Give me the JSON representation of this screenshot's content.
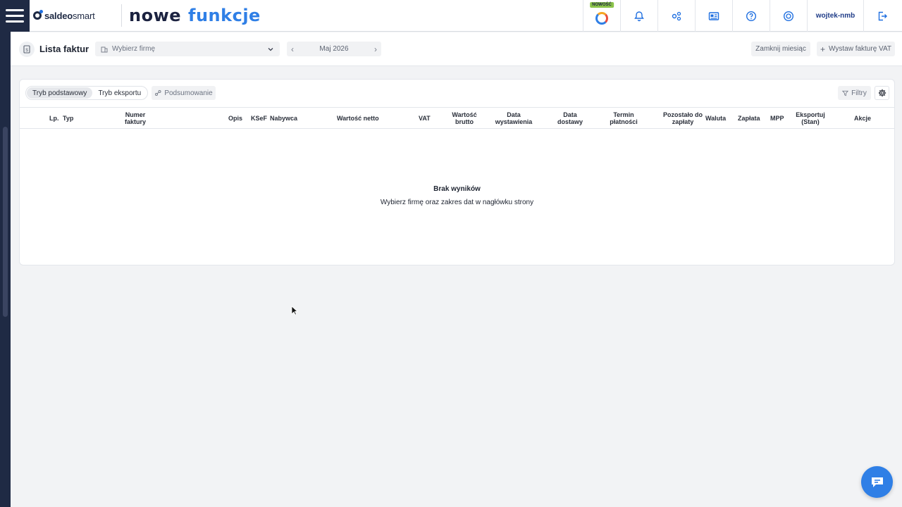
{
  "topbar": {
    "logo": {
      "brand_bold": "saldeo",
      "brand_light": "smart"
    },
    "promo": {
      "word1": "nowe",
      "word2": "funkcje"
    },
    "new_badge": "NOWOŚĆ",
    "user": "wojtek-nmb",
    "icons": [
      "news-ring-icon",
      "bell-icon",
      "integrations-icon",
      "newsletter-icon",
      "help-icon",
      "support-icon",
      "logout-icon"
    ]
  },
  "page_header": {
    "title": "Lista faktur",
    "firm_placeholder": "Wybierz firmę",
    "month": "Maj 2026",
    "close_month": "Zamknij miesiąc",
    "issue_vat": "Wystaw fakturę VAT"
  },
  "toolbar": {
    "mode_basic": "Tryb podstawowy",
    "mode_export": "Tryb eksportu",
    "summary": "Podsumowanie",
    "filters": "Filtry"
  },
  "table": {
    "columns": [
      "Lp.",
      "Typ",
      "Numer faktury",
      "Opis",
      "KSeF",
      "Nabywca",
      "Wartość netto",
      "VAT",
      "Wartość brutto",
      "Data wystawienia",
      "Data dostawy",
      "Termin płatności",
      "Pozostało do zapłaty",
      "Waluta",
      "Zapłata",
      "MPP",
      "Eksportuj (Stan)",
      "Akcje"
    ],
    "empty_title": "Brak wyników",
    "empty_text": "Wybierz firmę oraz zakres dat w nagłówku strony"
  },
  "colors": {
    "navy": "#1f2a44",
    "accent": "#2f7fe6",
    "background": "#f2f3f5"
  }
}
